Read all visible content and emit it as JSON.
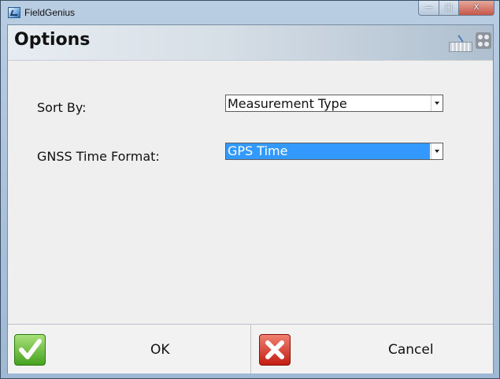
{
  "window": {
    "title": "FieldGenius",
    "controls": {
      "minimize": "—",
      "maximize": "□",
      "close": "X"
    }
  },
  "header": {
    "title": "Options",
    "icons": [
      "keyboard-icon",
      "grid-menu-icon"
    ]
  },
  "form": {
    "sort_by": {
      "label": "Sort By:",
      "value": "Measurement Type"
    },
    "gnss_time_format": {
      "label": "GNSS Time Format:",
      "value": "GPS Time"
    }
  },
  "footer": {
    "ok_label": "OK",
    "cancel_label": "Cancel"
  },
  "colors": {
    "selection": "#3399ff",
    "ok_green": "#46a21f",
    "cancel_red": "#c41d12"
  }
}
